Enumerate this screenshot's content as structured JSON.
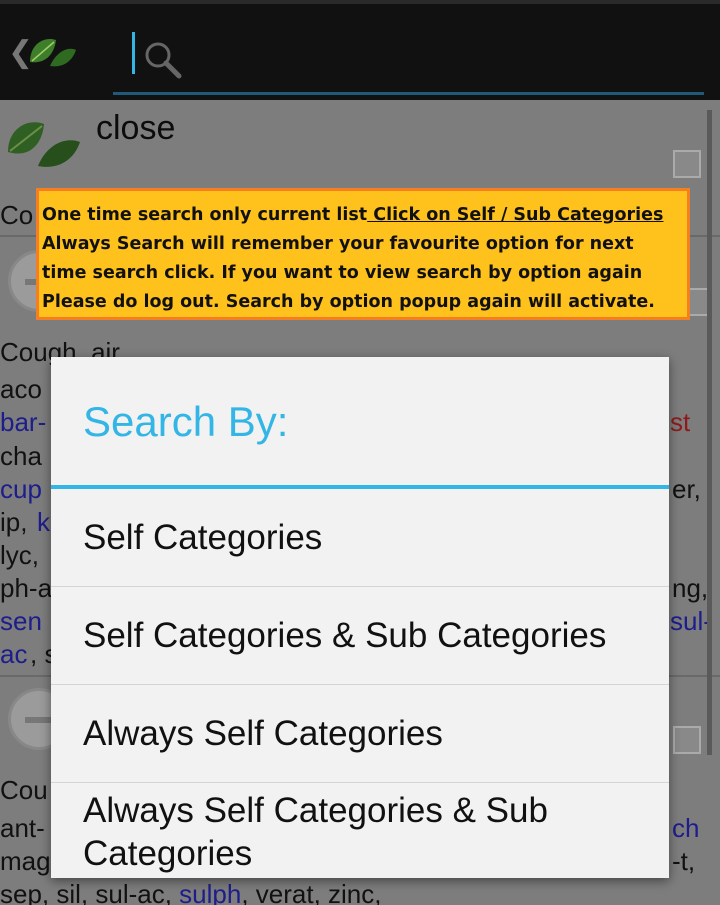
{
  "close_label": "close",
  "background_rows": {
    "row1_prefix": "Co",
    "row2_heading": "Cough, air",
    "line_a": "aco",
    "line_b_start": "bar-",
    "line_b_end": "st",
    "line_c": "cha",
    "line_d_start": "cup",
    "line_d_end": "er,",
    "line_e_start": "ip,",
    "line_e_mid": "k",
    "line_f": "lyc,",
    "line_g_start": "ph-a",
    "line_g_end": "ng,",
    "line_h_start": "sen",
    "line_h_end": "sul-",
    "line_i_start": "ac",
    "line_i_mid": ", s",
    "row3_prefix": "Cou",
    "line_j_start": "ant-",
    "line_j_end": "ch",
    "line_k_start": "mag",
    "line_k_end": "-t,",
    "line_l_a": "sep, sil, sul-ac, ",
    "line_l_b": "sulph",
    "line_l_c": ", verat, zinc,"
  },
  "tooltip": {
    "line1": "One time search only current list",
    "line1_link": " Click on Self / Sub Categories ",
    "line2": "Always Search will remember your favourite option for next",
    "line3": "time search click. If you want to view search by option again",
    "line4": "Please do log out. Search by option popup again will activate."
  },
  "dialog": {
    "title": "Search By:",
    "options": [
      {
        "label": "Self Categories"
      },
      {
        "label": "Self Categories & Sub Categories"
      },
      {
        "label": "Always Self Categories"
      },
      {
        "label": "Always Self Categories & Sub Categories"
      }
    ]
  },
  "colors": {
    "accent": "#33b5e5",
    "tooltip_bg": "#ffc21c",
    "tooltip_border": "#f57f20"
  }
}
